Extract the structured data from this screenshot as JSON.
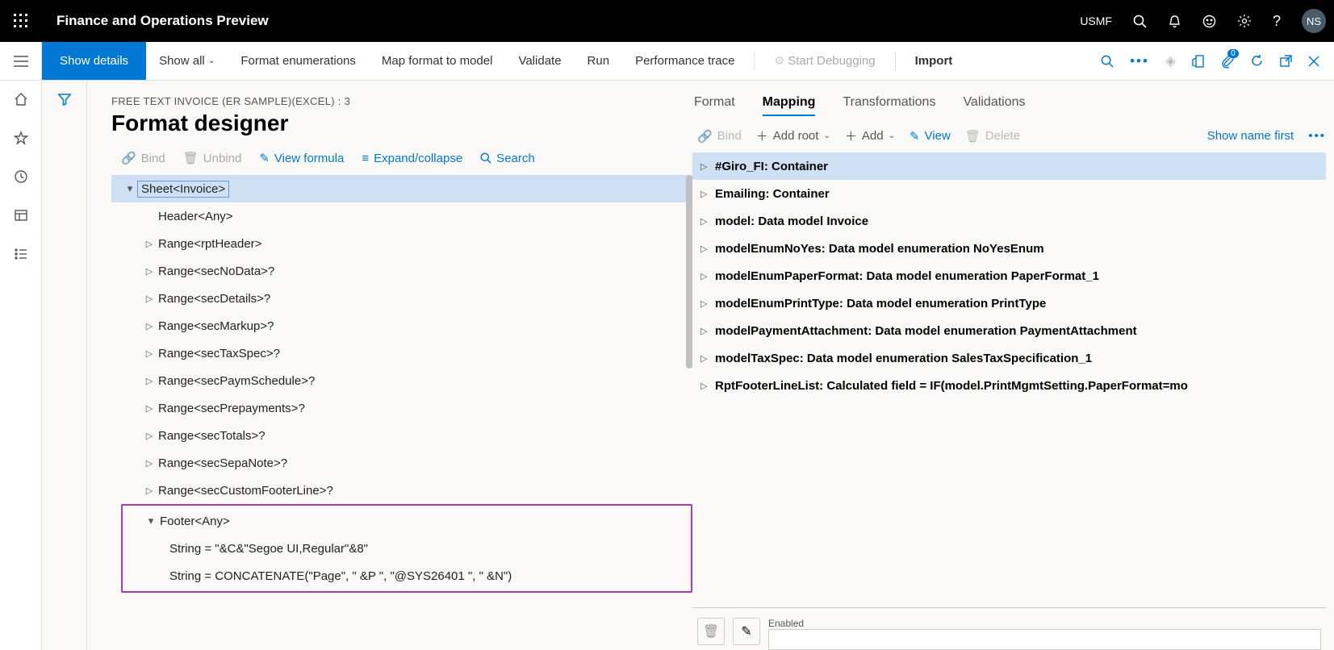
{
  "topbar": {
    "title": "Finance and Operations Preview",
    "company": "USMF",
    "avatar": "NS"
  },
  "cmdbar": {
    "show_details": "Show details",
    "show_all": "Show all",
    "format_enum": "Format enumerations",
    "map_format": "Map format to model",
    "validate": "Validate",
    "run": "Run",
    "perf_trace": "Performance trace",
    "start_debug": "Start Debugging",
    "import": "Import"
  },
  "breadcrumb": "FREE TEXT INVOICE (ER SAMPLE)(EXCEL) : 3",
  "pagetitle": "Format designer",
  "local_toolbar": {
    "bind": "Bind",
    "unbind": "Unbind",
    "view_formula": "View formula",
    "expand": "Expand/collapse",
    "search": "Search"
  },
  "tree": {
    "root": "Sheet<Invoice>",
    "children": [
      "Header<Any>",
      "Range<rptHeader>",
      "Range<secNoData>?",
      "Range<secDetails>?",
      "Range<secMarkup>?",
      "Range<secTaxSpec>?",
      "Range<secPaymSchedule>?",
      "Range<secPrepayments>?",
      "Range<secTotals>?",
      "Range<secSepaNote>?",
      "Range<secCustomFooterLine>?"
    ],
    "footer": {
      "label": "Footer<Any>",
      "strings": [
        "String = \"&C&\"Segoe UI,Regular\"&8\"",
        "String = CONCATENATE(\"Page\", \" &P \", \"@SYS26401 \", \" &N\")"
      ]
    }
  },
  "tabs": {
    "format": "Format",
    "mapping": "Mapping",
    "transformations": "Transformations",
    "validations": "Validations"
  },
  "right_toolbar": {
    "bind": "Bind",
    "add_root": "Add root",
    "add": "Add",
    "view": "View",
    "delete": "Delete",
    "show_name_first": "Show name first"
  },
  "mapping_tree": [
    "#Giro_FI: Container",
    "Emailing: Container",
    "model: Data model Invoice",
    "modelEnumNoYes: Data model enumeration NoYesEnum",
    "modelEnumPaperFormat: Data model enumeration PaperFormat_1",
    "modelEnumPrintType: Data model enumeration PrintType",
    "modelPaymentAttachment: Data model enumeration PaymentAttachment",
    "modelTaxSpec: Data model enumeration SalesTaxSpecification_1",
    "RptFooterLineList: Calculated field = IF(model.PrintMgmtSetting.PaperFormat=mo"
  ],
  "bottom_field": "Enabled",
  "badge_count": "0"
}
